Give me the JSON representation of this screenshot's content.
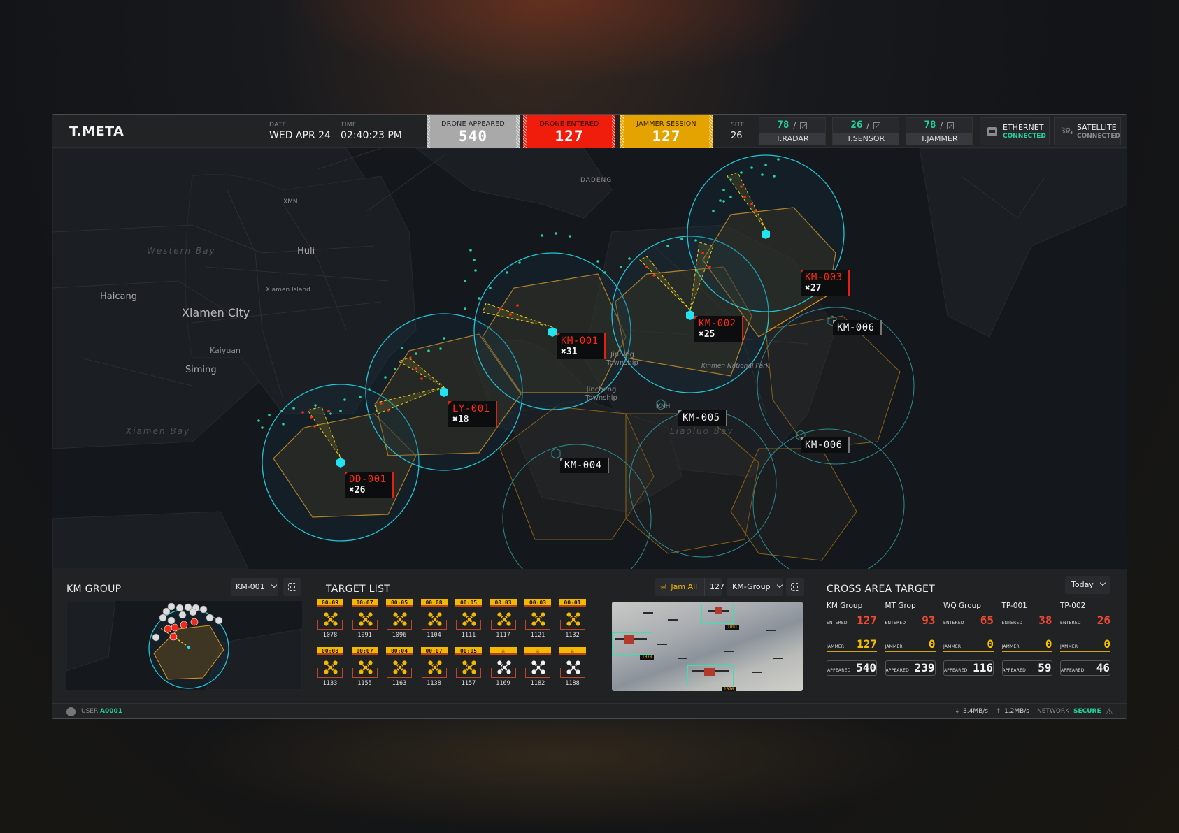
{
  "app": {
    "title": "T.META"
  },
  "header": {
    "date_label": "DATE",
    "date": "WED APR 24",
    "time_label": "TIME",
    "time": "02:40:23 PM",
    "stats": [
      {
        "label": "DRONE APPEARED",
        "value": "540",
        "color": "#a9a9a9"
      },
      {
        "label": "DRONE ENTERED",
        "value": "127",
        "color": "#f11d0c"
      },
      {
        "label": "JAMMER SESSION",
        "value": "127",
        "color": "#e4a300"
      }
    ],
    "site_label": "SITE",
    "site": "26",
    "devices": [
      {
        "count": "78",
        "sep": "/",
        "name": "T.RADAR"
      },
      {
        "count": "26",
        "sep": "/",
        "name": "T.SENSOR"
      },
      {
        "count": "78",
        "sep": "/",
        "name": "T.JAMMER"
      }
    ],
    "connections": [
      {
        "name": "ETHERNET",
        "status": "CONNECTED",
        "status_color": "#21d39a",
        "icon": "ethernet-icon"
      },
      {
        "name": "SATELLITE",
        "status": "CONNECTED",
        "status_color": "#8a8a8a",
        "icon": "satellite-icon"
      }
    ]
  },
  "map": {
    "labels": {
      "xmn": "XMN",
      "huli": "Huli",
      "western_bay": "Western Bay",
      "haicang": "Haicang",
      "xiamen_island": "Xiamen Island",
      "xiamen_city": "Xiamen City",
      "kaiyuan": "Kaiyuan",
      "siming": "Siming",
      "xiamen_bay": "Xiamen Bay",
      "dadeng": "DADENG",
      "jinning": "Jinning Township",
      "jincheng": "Jincheng Township",
      "knh": "KNH",
      "kinmen_park": "Kinmen National Park",
      "liaoluo_bay": "Liaoluo Bay"
    },
    "zones": [
      {
        "id": "DD-001",
        "count": "26",
        "active": true
      },
      {
        "id": "LY-001",
        "count": "18",
        "active": true
      },
      {
        "id": "KM-001",
        "count": "31",
        "active": true
      },
      {
        "id": "KM-002",
        "count": "25",
        "active": true
      },
      {
        "id": "KM-003",
        "count": "27",
        "active": true
      },
      {
        "id": "KM-004",
        "active": false
      },
      {
        "id": "KM-005",
        "active": false
      },
      {
        "id": "KM-006",
        "active": false
      },
      {
        "id": "KM-006",
        "active": false
      }
    ],
    "count_prefix": "✖"
  },
  "km_group": {
    "title": "KM GROUP",
    "selected": "KM-001"
  },
  "target_list": {
    "title": "TARGET LIST",
    "jam_all_label": "Jam All",
    "jam_count": "127",
    "group_selected": "KM-Group",
    "targets": [
      {
        "timer": "00:09",
        "id": "1078",
        "jammed": false
      },
      {
        "timer": "00:07",
        "id": "1091",
        "jammed": false
      },
      {
        "timer": "00:05",
        "id": "1096",
        "jammed": false
      },
      {
        "timer": "00:08",
        "id": "1104",
        "jammed": false
      },
      {
        "timer": "00:05",
        "id": "1111",
        "jammed": false
      },
      {
        "timer": "00:03",
        "id": "1117",
        "jammed": false
      },
      {
        "timer": "00:03",
        "id": "1121",
        "jammed": false
      },
      {
        "timer": "00:01",
        "id": "1132",
        "jammed": false
      },
      {
        "timer": "00:08",
        "id": "1133",
        "jammed": false
      },
      {
        "timer": "00:07",
        "id": "1155",
        "jammed": false
      },
      {
        "timer": "00:04",
        "id": "1163",
        "jammed": false
      },
      {
        "timer": "00:07",
        "id": "1138",
        "jammed": false
      },
      {
        "timer": "00:05",
        "id": "1157",
        "jammed": false
      },
      {
        "timer": "☠",
        "id": "1169",
        "jammed": true
      },
      {
        "timer": "☠",
        "id": "1182",
        "jammed": true
      },
      {
        "timer": "☠",
        "id": "1188",
        "jammed": true
      }
    ],
    "video_tags": [
      "1091",
      "1078",
      "1076"
    ]
  },
  "cross_area": {
    "title": "CROSS AREA TARGET",
    "period": "Today",
    "row_labels": {
      "entered": "ENTERED",
      "jammer": "JAMMER",
      "appeared": "APPEARED"
    },
    "groups": [
      {
        "name": "KM Group",
        "entered": "127",
        "jammer": "127",
        "appeared": "540"
      },
      {
        "name": "MT Grop",
        "entered": "93",
        "jammer": "0",
        "appeared": "239"
      },
      {
        "name": "WQ Group",
        "entered": "65",
        "jammer": "0",
        "appeared": "116"
      },
      {
        "name": "TP-001",
        "entered": "38",
        "jammer": "0",
        "appeared": "59"
      },
      {
        "name": "TP-002",
        "entered": "26",
        "jammer": "0",
        "appeared": "46"
      }
    ]
  },
  "footer": {
    "user_label": "USER",
    "user": "A0001",
    "download": "3.4MB/s",
    "upload": "1.2MB/s",
    "network_label": "NETWORK",
    "network_status": "SECURE"
  }
}
